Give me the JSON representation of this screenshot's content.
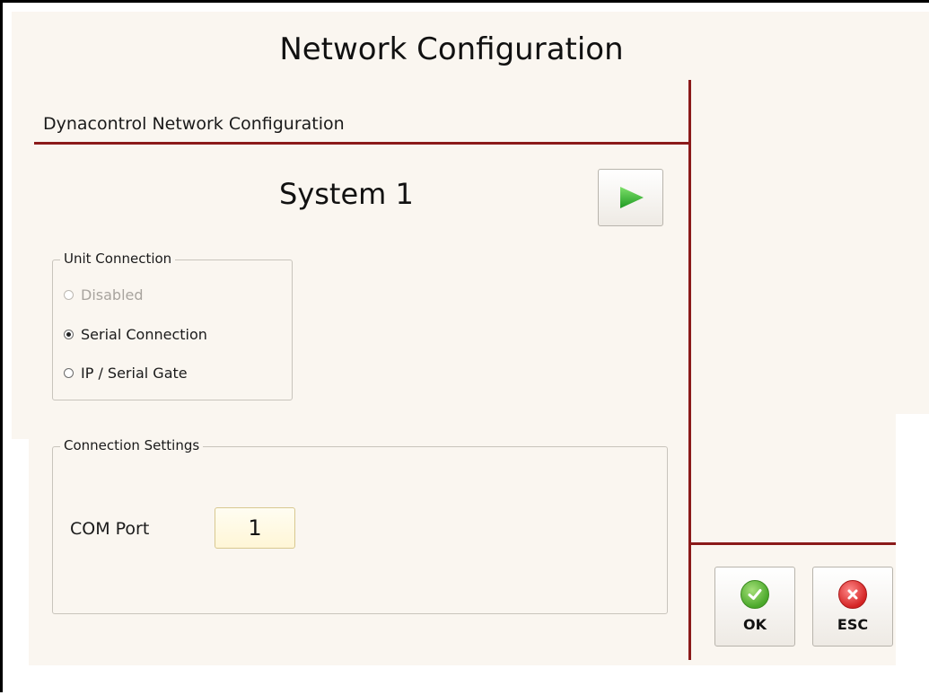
{
  "window": {
    "title": "Network Configuration"
  },
  "section": {
    "header": "Dynacontrol Network Configuration"
  },
  "system": {
    "title": "System 1",
    "play_icon": "play-icon"
  },
  "unit_connection": {
    "legend": "Unit Connection",
    "options": [
      {
        "label": "Disabled",
        "checked": false,
        "enabled": false
      },
      {
        "label": "Serial Connection",
        "checked": true,
        "enabled": true
      },
      {
        "label": "IP / Serial Gate",
        "checked": false,
        "enabled": true
      }
    ]
  },
  "connection_settings": {
    "legend": "Connection Settings",
    "com_port_label": "COM Port",
    "com_port_value": "1"
  },
  "actions": {
    "ok_label": "OK",
    "esc_label": "ESC",
    "ok_icon": "checkmark-icon",
    "esc_icon": "close-icon"
  },
  "colors": {
    "accent_line": "#8b1a1a",
    "background": "#faf6f0",
    "ok_green": "#4aa82a",
    "esc_red": "#d42424",
    "play_green": "#2fa82a"
  }
}
